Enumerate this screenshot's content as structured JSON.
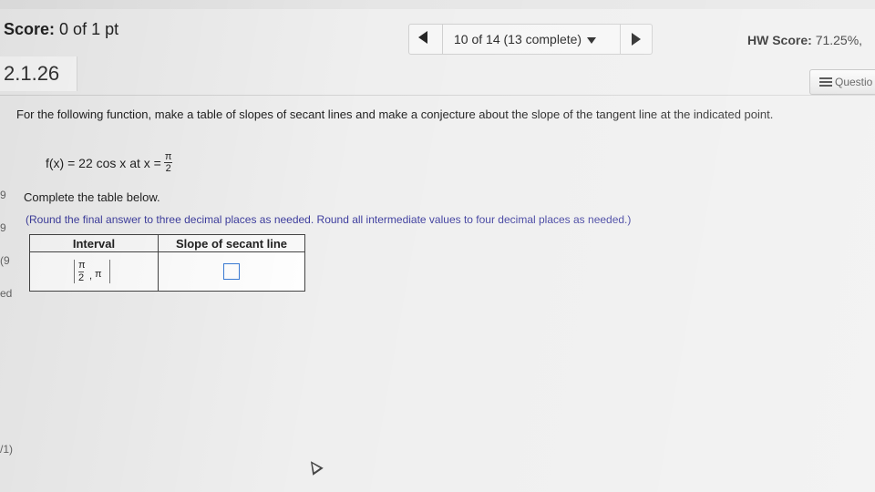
{
  "header": {
    "score_label": "Score:",
    "score_value": "0 of 1 pt",
    "nav": {
      "progress": "10 of 14 (13 complete)"
    },
    "hw_score_label": "HW Score:",
    "hw_score_value": "71.25%,"
  },
  "question": {
    "id": "2.1.26",
    "help_button": "Questio",
    "prompt": "For the following function, make a table of slopes of secant lines and make a conjecture about the slope of the tangent line at the indicated point.",
    "function_text": "f(x) = 22 cos x at x =",
    "x_num": "π",
    "x_den": "2",
    "instruction": "Complete the table below.",
    "note": "(Round the final answer to three decimal places as needed. Round all intermediate values to four decimal places as needed.)",
    "table": {
      "headers": [
        "Interval",
        "Slope of secant line"
      ],
      "interval_num": "π",
      "interval_den": "2",
      "interval_sep": ",",
      "interval_end": "π"
    }
  },
  "left_edge": [
    "9",
    "9",
    "(9",
    "ed"
  ],
  "footer_glyph": "/1)"
}
